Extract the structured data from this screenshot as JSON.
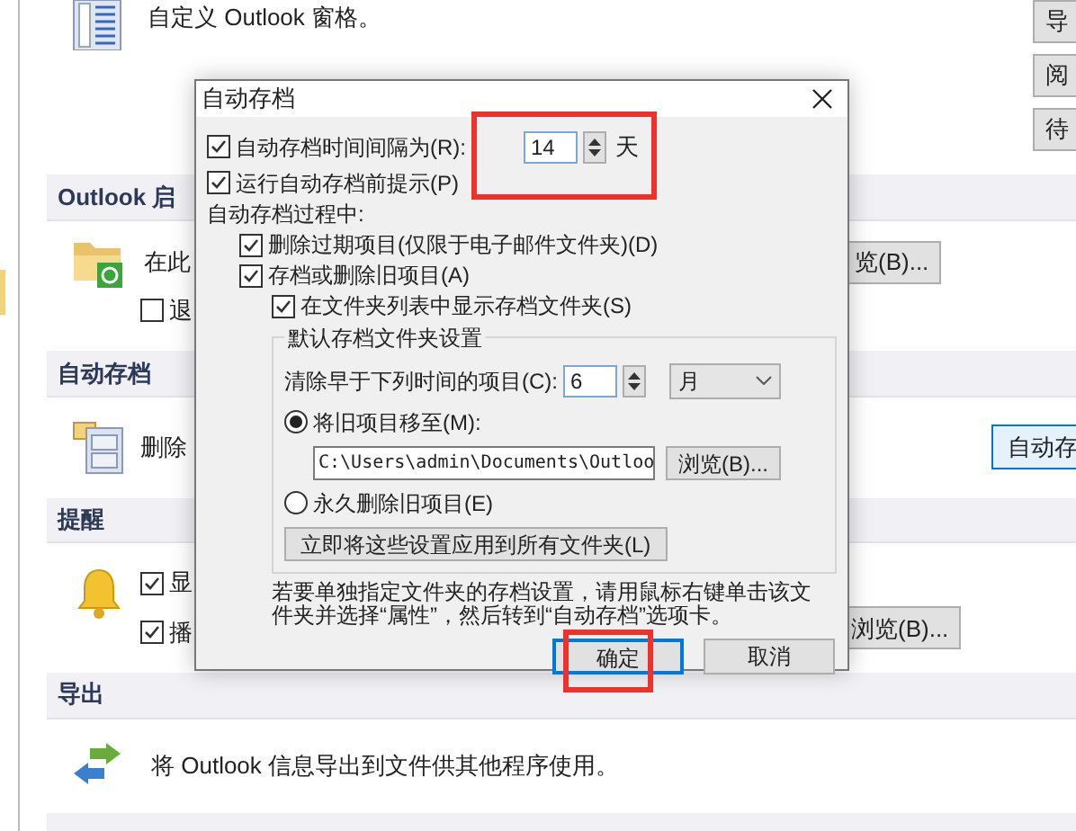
{
  "background": {
    "intro_text": "自定义 Outlook 窗格。",
    "right_buttons": [
      "导",
      "阅",
      "待"
    ],
    "startup": {
      "title": "Outlook 启",
      "text": "在此",
      "checkbox": {
        "label": "退",
        "checked": false
      },
      "button": "览(B)..."
    },
    "archive": {
      "title": "自动存档",
      "text": "删除",
      "button": "自动存"
    },
    "reminders": {
      "title": "提醒",
      "checkboxes": [
        {
          "label": "显",
          "checked": true
        },
        {
          "label": "播",
          "checked": true
        }
      ],
      "button": "浏览(B)..."
    },
    "export": {
      "title": "导出",
      "text": "将 Outlook 信息导出到文件供其他程序使用。"
    }
  },
  "dialog": {
    "title": "自动存档",
    "interval": {
      "label": "自动存档时间间隔为(R):",
      "checked": true,
      "value": "14",
      "unit": "天"
    },
    "prompt": {
      "label": "运行自动存档前提示(P)",
      "checked": true
    },
    "during_label": "自动存档过程中:",
    "delete_expired": {
      "label": "删除过期项目(仅限于电子邮件文件夹)(D)",
      "checked": true
    },
    "archive_old": {
      "label": "存档或删除旧项目(A)",
      "checked": true
    },
    "show_folder": {
      "label": "在文件夹列表中显示存档文件夹(S)",
      "checked": true
    },
    "group": {
      "title": "默认存档文件夹设置",
      "clean_label": "清除早于下列时间的项目(C):",
      "clean_value": "6",
      "clean_unit": "月",
      "options": [
        {
          "label": "将旧项目移至(M):",
          "selected": true
        },
        {
          "label": "永久删除旧项目(E)",
          "selected": false
        }
      ],
      "path": "C:\\Users\\admin\\Documents\\Outloo",
      "browse": "浏览(B)...",
      "apply": "立即将这些设置应用到所有文件夹(L)"
    },
    "note": "若要单独指定文件夹的存档设置，请用鼠标右键单击该文件夹并选择“属性”，然后转到“自动存档”选项卡。",
    "ok": "确定",
    "cancel": "取消"
  }
}
